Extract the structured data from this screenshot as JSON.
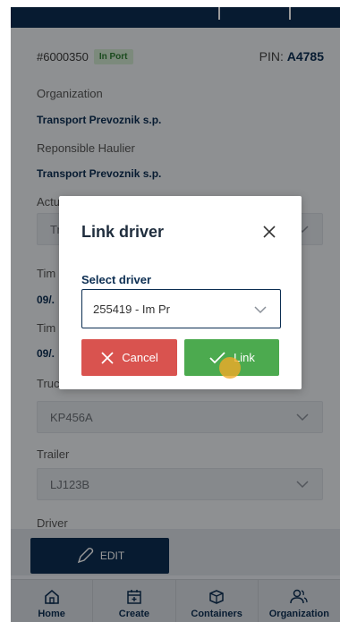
{
  "order": {
    "number": "#6000350",
    "status_badge": "In Port",
    "pin_label": "PIN:",
    "pin_value": "A4785"
  },
  "details": {
    "organization_label": "Organization",
    "organization_value": "Transport Prevoznik s.p.",
    "responsible_label": "Reponsible Haulier",
    "responsible_value": "Transport Prevoznik s.p.",
    "actual_label": "Actual Haulier",
    "actual_value": "Tr",
    "time1_label": "Tim",
    "time1_value": "09/.",
    "time2_label": "Tim",
    "time2_value": "09/.",
    "truck_label": "Truc",
    "truck_value": "KP456A",
    "trailer_label": "Trailer",
    "trailer_value": "LJ123B",
    "driver_label": "Driver"
  },
  "edit_button": "EDIT",
  "nav": {
    "items": [
      {
        "label": "Home",
        "icon": "home-icon"
      },
      {
        "label": "Create",
        "icon": "calendar-plus-icon"
      },
      {
        "label": "Containers",
        "icon": "container-box-icon"
      },
      {
        "label": "Organization",
        "icon": "users-icon"
      }
    ]
  },
  "modal": {
    "title": "Link driver",
    "select_label": "Select driver",
    "select_value": "255419 - Im Pr",
    "cancel_label": "Cancel",
    "link_label": "Link"
  },
  "colors": {
    "primary": "#0c2e52",
    "cancel": "#d9534f",
    "confirm": "#4caa4f",
    "badge_bg": "#cfe6cf"
  }
}
